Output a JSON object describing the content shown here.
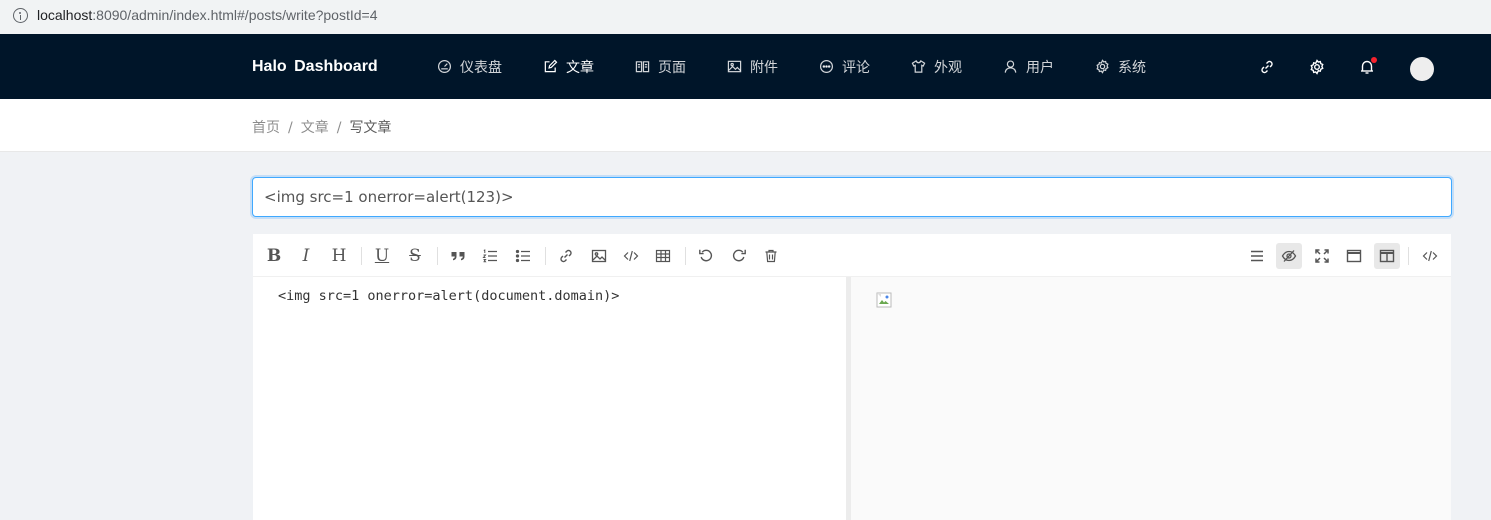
{
  "browser": {
    "host": "localhost",
    "url_rest": ":8090/admin/index.html#/posts/write?postId=4"
  },
  "nav": {
    "brand": "Halo Dashboard",
    "items": [
      {
        "label": "仪表盘",
        "icon": "dashboard-icon"
      },
      {
        "label": "文章",
        "icon": "edit-icon",
        "active": true
      },
      {
        "label": "页面",
        "icon": "book-icon"
      },
      {
        "label": "附件",
        "icon": "picture-icon"
      },
      {
        "label": "评论",
        "icon": "message-icon"
      },
      {
        "label": "外观",
        "icon": "skin-icon"
      },
      {
        "label": "用户",
        "icon": "user-icon"
      },
      {
        "label": "系统",
        "icon": "setting-icon"
      }
    ],
    "right_icons": [
      "link-icon",
      "gear-icon",
      "bell-icon",
      "avatar"
    ]
  },
  "breadcrumb": [
    "首页",
    "文章",
    "写文章"
  ],
  "post": {
    "title_value": "<img src=1 onerror=alert(123)>"
  },
  "editor": {
    "content": "<img src=1 onerror=alert(document.domain)>",
    "toolbar_left": [
      "bold",
      "italic",
      "heading",
      "underline",
      "strikethrough",
      "quote",
      "ordered-list",
      "unordered-list",
      "link",
      "image",
      "code",
      "table",
      "undo",
      "redo",
      "trash"
    ],
    "toolbar_right": [
      "navigation",
      "preview",
      "fullscreen",
      "single-column",
      "double-column",
      "html-code"
    ]
  },
  "colors": {
    "nav_bg": "#001529",
    "focus_border": "#40a9ff",
    "badge": "#f5222d"
  }
}
